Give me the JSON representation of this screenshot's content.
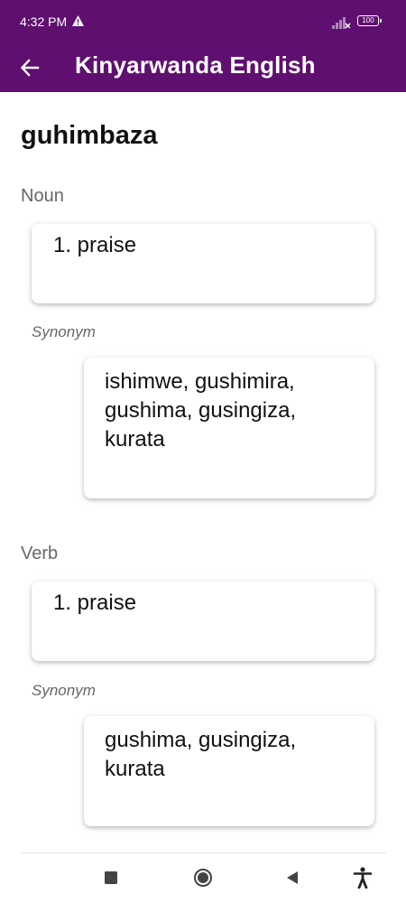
{
  "status_bar": {
    "time": "4:32 PM",
    "battery": "100"
  },
  "app_bar": {
    "title": "Kinyarwanda English"
  },
  "entry": {
    "headword": "guhimbaza",
    "senses": [
      {
        "pos": "Noun",
        "meaning": "1. praise",
        "synonym_label": "Synonym",
        "synonyms": "ishimwe, gushimira, gushima, gusingiza, kurata"
      },
      {
        "pos": "Verb",
        "meaning": "1. praise",
        "synonym_label": "Synonym",
        "synonyms": "gushima, gusingiza, kurata"
      }
    ]
  },
  "colors": {
    "primary": "#5f0f70",
    "secondary_text": "#666666"
  }
}
